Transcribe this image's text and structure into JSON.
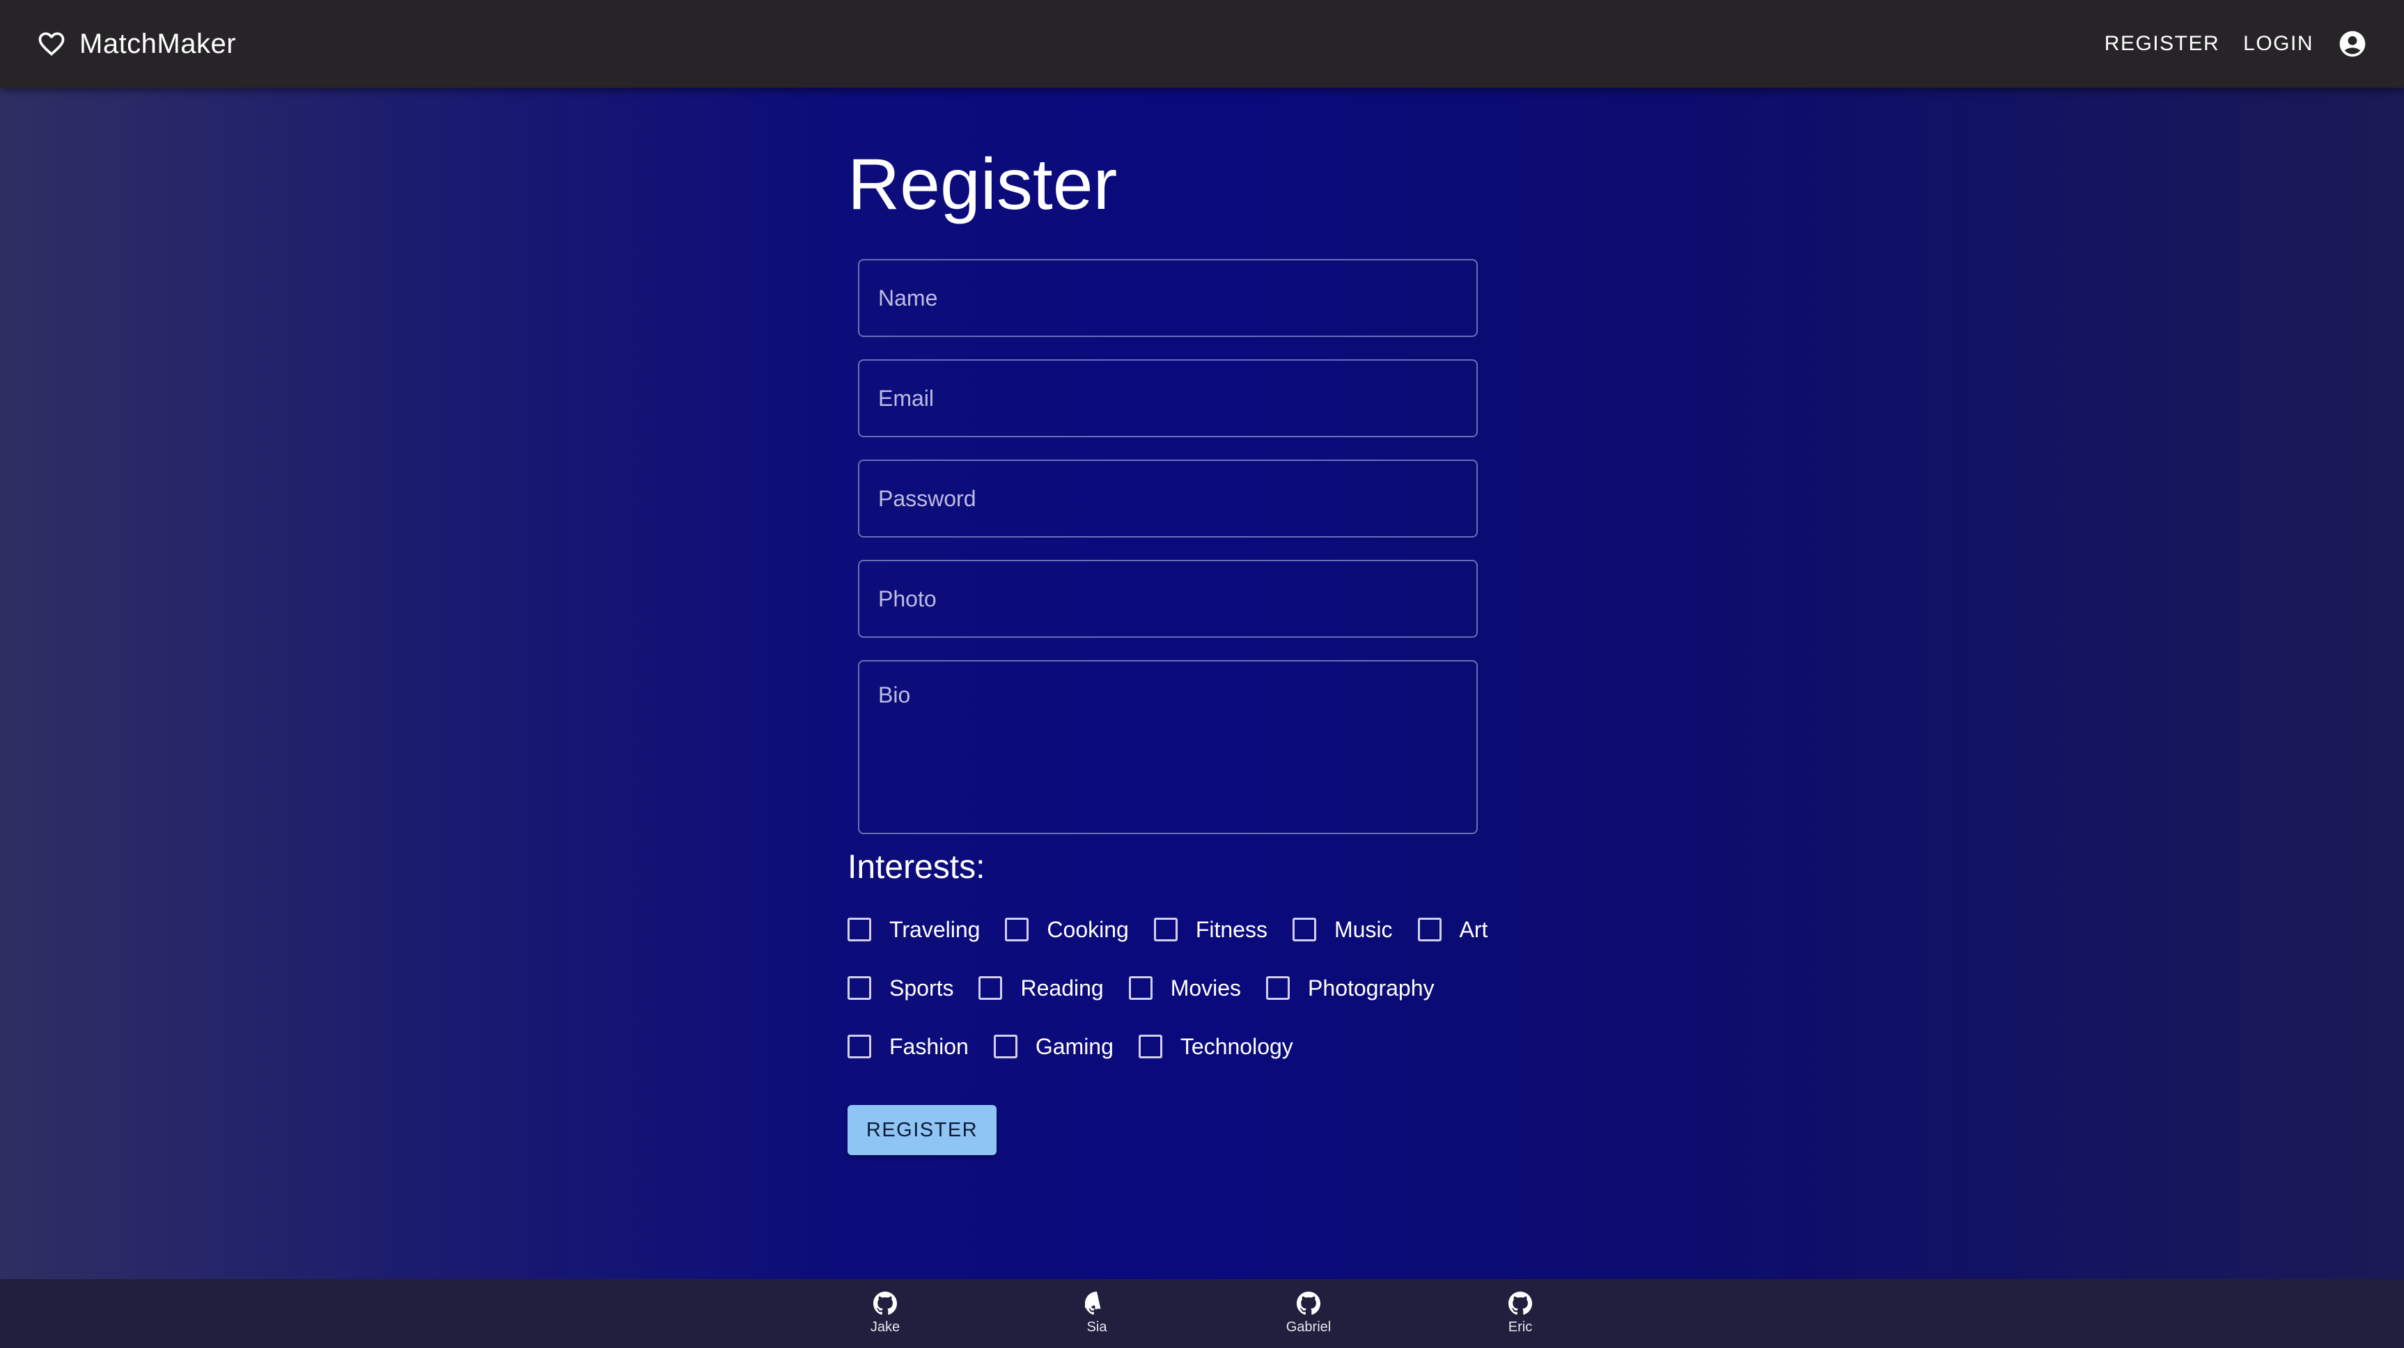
{
  "header": {
    "brand": "MatchMaker",
    "brand_icon": "heart-outline-icon",
    "nav": {
      "register": "REGISTER",
      "login": "LOGIN"
    },
    "account_icon": "account-circle-icon"
  },
  "form": {
    "title": "Register",
    "fields": {
      "name": {
        "placeholder": "Name",
        "value": ""
      },
      "email": {
        "placeholder": "Email",
        "value": ""
      },
      "password": {
        "placeholder": "Password",
        "value": ""
      },
      "photo": {
        "placeholder": "Photo",
        "value": ""
      },
      "bio": {
        "placeholder": "Bio",
        "value": ""
      }
    },
    "interests_title": "Interests:",
    "interests": [
      {
        "label": "Traveling",
        "checked": false
      },
      {
        "label": "Cooking",
        "checked": false
      },
      {
        "label": "Fitness",
        "checked": false
      },
      {
        "label": "Music",
        "checked": false
      },
      {
        "label": "Art",
        "checked": false
      },
      {
        "label": "Sports",
        "checked": false
      },
      {
        "label": "Reading",
        "checked": false
      },
      {
        "label": "Movies",
        "checked": false
      },
      {
        "label": "Photography",
        "checked": false
      },
      {
        "label": "Fashion",
        "checked": false
      },
      {
        "label": "Gaming",
        "checked": false
      },
      {
        "label": "Technology",
        "checked": false
      }
    ],
    "submit_label": "REGISTER"
  },
  "footer": {
    "contributors": [
      {
        "name": "Jake",
        "icon": "github-icon"
      },
      {
        "name": "Sia",
        "icon": "github-icon"
      },
      {
        "name": "Gabriel",
        "icon": "github-icon"
      },
      {
        "name": "Eric",
        "icon": "github-icon"
      }
    ]
  },
  "colors": {
    "appbar": "#272427",
    "button": "#8ec5f5",
    "footer": "#20203e",
    "background_center": "#0a0a7d"
  }
}
